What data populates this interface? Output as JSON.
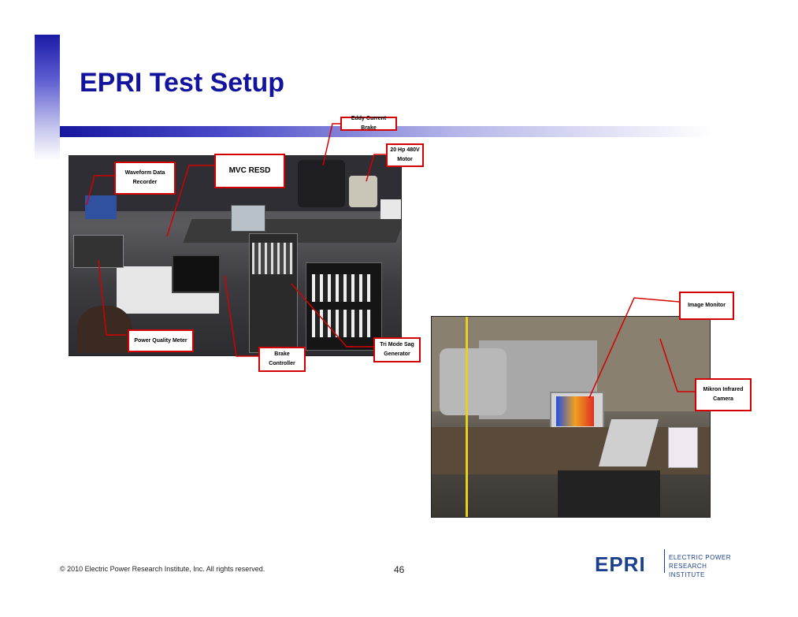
{
  "slide": {
    "title": "EPRI Test Setup"
  },
  "callouts": {
    "eddy_current_brake": "Eddy Current Brake",
    "motor": "20 Hp 480V Motor",
    "waveform_recorder": "Waveform Data Recorder",
    "mvc_resd": "MVC RESD",
    "power_quality_meter": "Power Quality Meter",
    "brake_controller": "Brake Controller",
    "tri_mode_sag_generator": "Tri Mode Sag Generator",
    "image_monitor": "Image Monitor",
    "mikron_infrared_camera": "Mikron Infrared Camera"
  },
  "footer": {
    "copyright": "© 2010 Electric Power Research Institute, Inc. All rights reserved.",
    "page_number": "46",
    "logo_mark": "EPRI",
    "logo_line1": "ELECTRIC POWER",
    "logo_line2": "RESEARCH INSTITUTE"
  },
  "colors": {
    "title": "#13149e",
    "callout_border": "#d40000",
    "logo": "#1b3f8f"
  }
}
